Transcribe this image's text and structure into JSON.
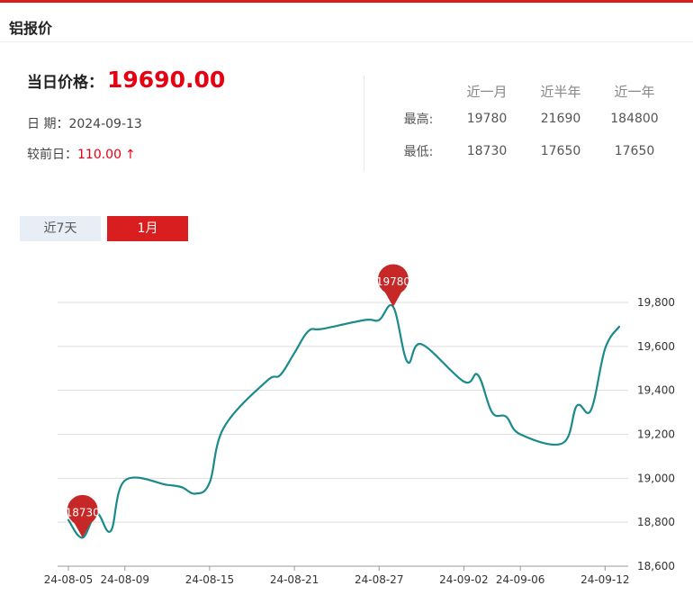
{
  "header": {
    "title": "铝报价"
  },
  "summary": {
    "price_label": "当日价格：",
    "price_value": "19690.00",
    "date_label": "日 期：",
    "date_value": "2024-09-13",
    "change_label": "较前日：",
    "change_value": "110.00",
    "change_arrow": "↑"
  },
  "stats": {
    "columns": [
      "近一月",
      "近半年",
      "近一年"
    ],
    "rows": [
      {
        "label": "最高:",
        "values": [
          "19780",
          "21690",
          "184800"
        ]
      },
      {
        "label": "最低:",
        "values": [
          "18730",
          "17650",
          "17650"
        ]
      }
    ]
  },
  "tabs": [
    {
      "label": "近7天",
      "active": false
    },
    {
      "label": "1月",
      "active": true
    }
  ],
  "colors": {
    "accent": "#d81e1e",
    "price": "#e60012",
    "line": "#1a8a8a",
    "marker": "#c62828"
  },
  "chart_data": {
    "type": "line",
    "x": [
      "24-08-05",
      "24-08-06",
      "24-08-07",
      "24-08-08",
      "24-08-09",
      "24-08-12",
      "24-08-13",
      "24-08-14",
      "24-08-15",
      "24-08-16",
      "24-08-19",
      "24-08-20",
      "24-08-21",
      "24-08-22",
      "24-08-23",
      "24-08-26",
      "24-08-27",
      "24-08-28",
      "24-08-29",
      "24-08-30",
      "24-09-02",
      "24-09-03",
      "24-09-04",
      "24-09-05",
      "24-09-06",
      "24-09-09",
      "24-09-10",
      "24-09-11",
      "24-09-12",
      "24-09-13"
    ],
    "x_ticks": [
      "24-08-05",
      "24-08-09",
      "24-08-15",
      "24-08-21",
      "24-08-27",
      "24-09-02",
      "24-09-06",
      "24-09-12"
    ],
    "series": [
      {
        "values": [
          18810,
          18730,
          18840,
          18760,
          18990,
          18970,
          18960,
          18930,
          18980,
          19230,
          19440,
          19470,
          19570,
          19670,
          19680,
          19720,
          19720,
          19780,
          19530,
          19610,
          19440,
          19470,
          19300,
          19280,
          19200,
          19160,
          19330,
          19310,
          19590,
          19690
        ]
      }
    ],
    "y_ticks": [
      18600,
      18800,
      19000,
      19200,
      19400,
      19600,
      19800
    ],
    "y_tick_labels": [
      "18,600",
      "18,800",
      "19,000",
      "19,200",
      "19,400",
      "19,600",
      "19,800"
    ],
    "ylim": [
      18600,
      19850
    ],
    "markers": [
      {
        "x": "24-08-06",
        "value": 18730,
        "label": "18730"
      },
      {
        "x": "24-08-28",
        "value": 19780,
        "label": "19780"
      }
    ],
    "title": "",
    "xlabel": "",
    "ylabel": "",
    "grid": true,
    "y_axis_position": "right"
  }
}
